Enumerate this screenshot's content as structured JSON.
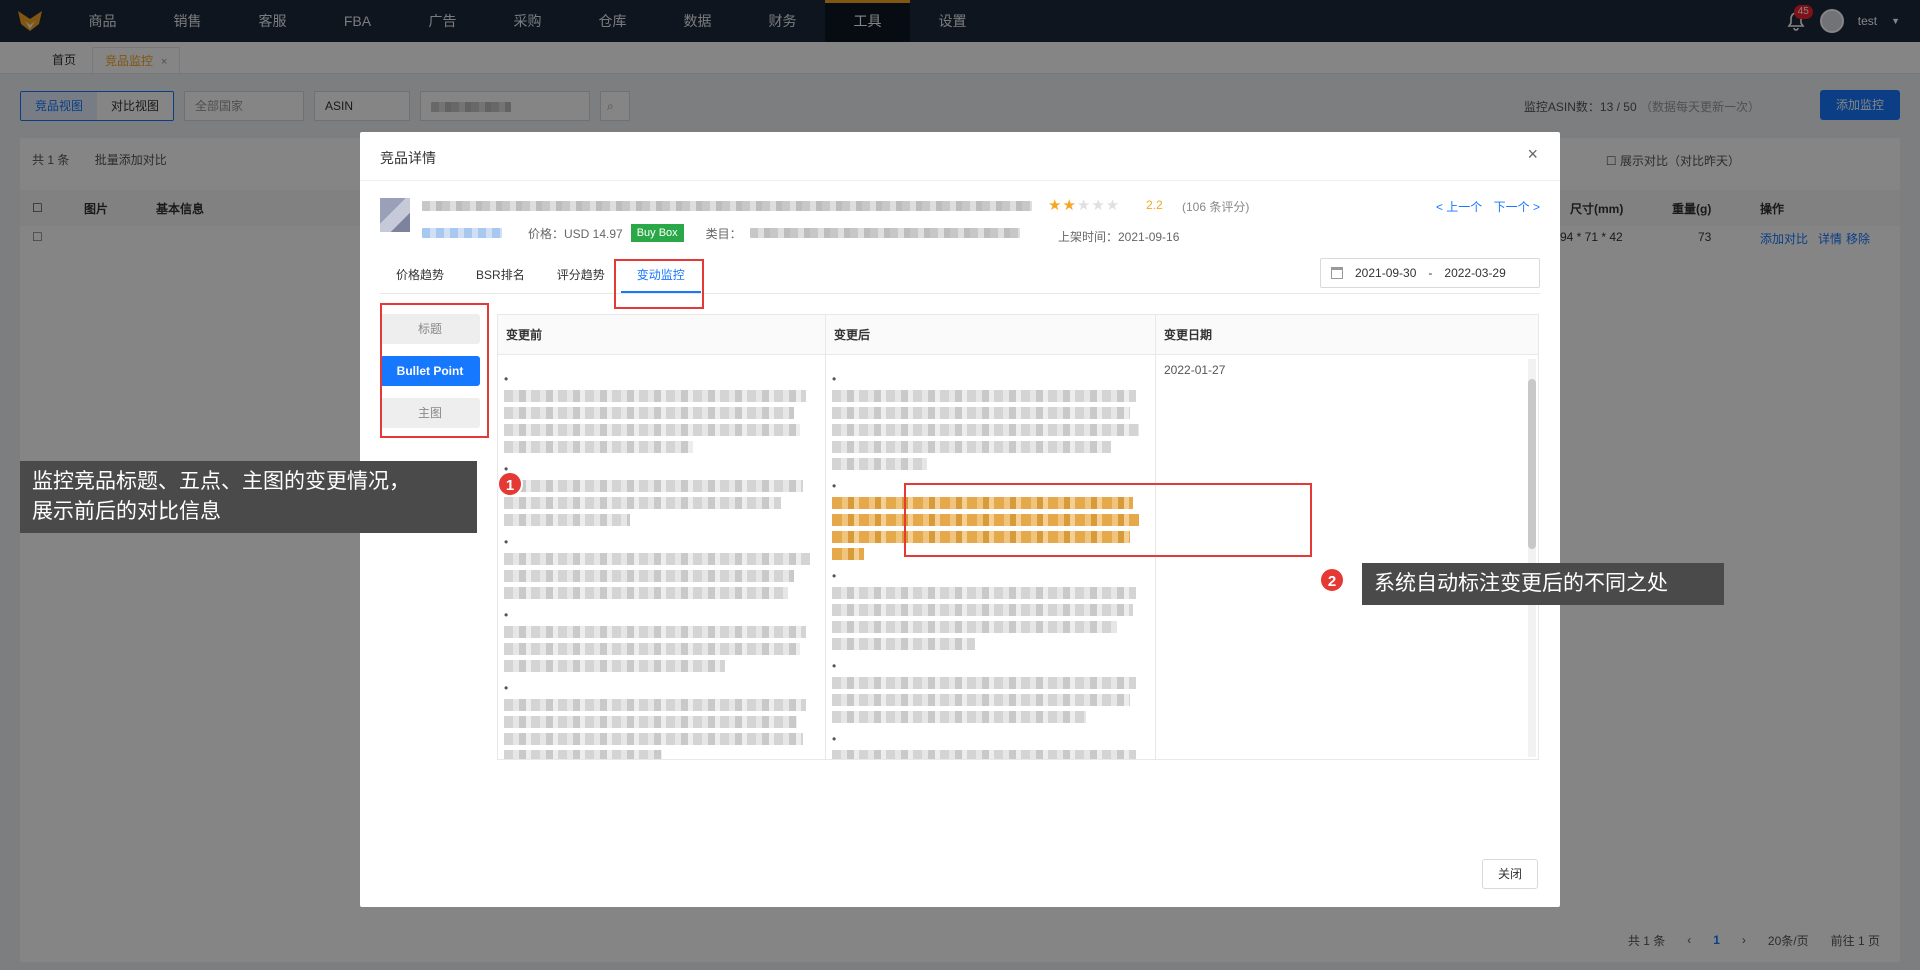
{
  "nav": {
    "items": [
      "商品",
      "销售",
      "客服",
      "FBA",
      "广告",
      "采购",
      "仓库",
      "数据",
      "财务",
      "工具",
      "设置"
    ],
    "active_index": 9,
    "notifications": "45",
    "user": "test"
  },
  "page_tabs": {
    "home": "首页",
    "current": "竞品监控",
    "close": "×"
  },
  "toolbar": {
    "view_product": "竞品视图",
    "view_compare": "对比视图",
    "country_placeholder": "全部国家",
    "search_type": "ASIN",
    "monitor_count_label": "监控ASIN数：13 / 50",
    "monitor_note": "（数据每天更新一次）",
    "add_button": "添加监控"
  },
  "list": {
    "total": "共 1 条",
    "batch_compare": "批量添加对比",
    "show_compare": "展示对比（对比昨天）",
    "headers": [
      "图片",
      "基本信息",
      "尺寸(mm)",
      "重量(g)",
      "操作"
    ],
    "row_size": "94 * 71 * 42",
    "row_weight": "73",
    "row_actions": [
      "添加对比",
      "详情",
      "移除"
    ]
  },
  "pager": {
    "total": "共 1 条",
    "page": "1",
    "per_page": "20条/页",
    "goto": "前往",
    "goto_value": "1",
    "page_unit": "页"
  },
  "modal": {
    "title": "竞品详情",
    "close_x": "×",
    "rating": "2.2",
    "rating_fraction": 0.44,
    "reviews": "(106 条评分)",
    "prev": "< 上一个",
    "next": "下一个 >",
    "price": "价格：USD 14.97",
    "buybox": "Buy Box",
    "category_label": "类目：",
    "listed_date": "上架时间：2021-09-16",
    "tabs": [
      "价格趋势",
      "BSR排名",
      "评分趋势",
      "变动监控"
    ],
    "active_tab": 3,
    "date_start": "2021-09-30",
    "date_sep": "-",
    "date_end": "2022-03-29",
    "side_buttons": [
      "标题",
      "Bullet Point",
      "主图"
    ],
    "active_side": 1,
    "columns": [
      "变更前",
      "变更后",
      "变更日期"
    ],
    "change_date": "2022-01-27",
    "close_button": "关闭"
  },
  "annotations": {
    "callout1": "监控竞品标题、五点、主图的变更情况，\n展示前后的对比信息",
    "marker1": "1",
    "callout2": "系统自动标注变更后的不同之处",
    "marker2": "2"
  }
}
